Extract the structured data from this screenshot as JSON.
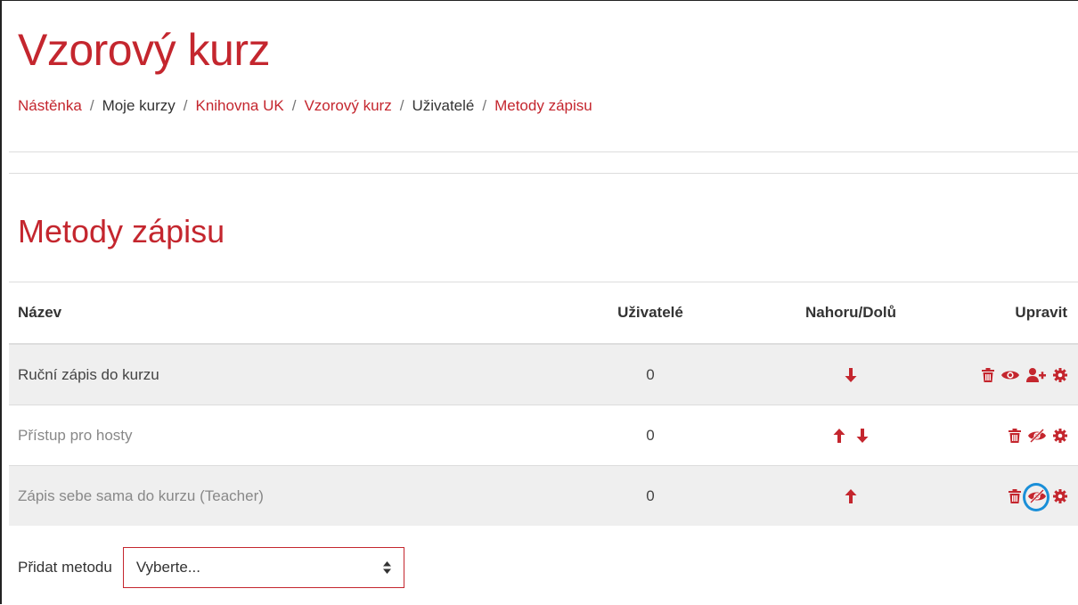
{
  "course": {
    "title": "Vzorový kurz"
  },
  "breadcrumb": [
    {
      "label": "Nástěnka",
      "link": true
    },
    {
      "label": "Moje kurzy",
      "link": false
    },
    {
      "label": "Knihovna UK",
      "link": true
    },
    {
      "label": "Vzorový kurz",
      "link": true
    },
    {
      "label": "Uživatelé",
      "link": false
    },
    {
      "label": "Metody zápisu",
      "link": true
    }
  ],
  "breadcrumb_separator": "/",
  "section": {
    "title": "Metody zápisu"
  },
  "table": {
    "headers": {
      "name": "Název",
      "users": "Uživatelé",
      "move": "Nahoru/Dolů",
      "edit": "Upravit"
    },
    "rows": [
      {
        "name": "Ruční zápis do kurzu",
        "users": "0",
        "move": [
          "down"
        ],
        "edit": [
          "trash-icon",
          "eye-icon",
          "enrol-users-icon",
          "gear-icon"
        ],
        "enabled": true
      },
      {
        "name": "Přístup pro hosty",
        "users": "0",
        "move": [
          "up",
          "down"
        ],
        "edit": [
          "trash-icon",
          "eye-slash-icon",
          "gear-icon"
        ],
        "enabled": false
      },
      {
        "name": "Zápis sebe sama do kurzu (Teacher)",
        "users": "0",
        "move": [
          "up"
        ],
        "edit": [
          "trash-icon",
          "eye-slash-icon",
          "gear-icon"
        ],
        "enabled": false,
        "highlighted_icon": "eye-slash-icon"
      }
    ]
  },
  "add_method": {
    "label": "Přidat metodu",
    "select_value": "Vyberte..."
  },
  "colors": {
    "accent": "#c4262e",
    "highlight": "#1a8fd8",
    "row_stripe": "#efefef"
  }
}
